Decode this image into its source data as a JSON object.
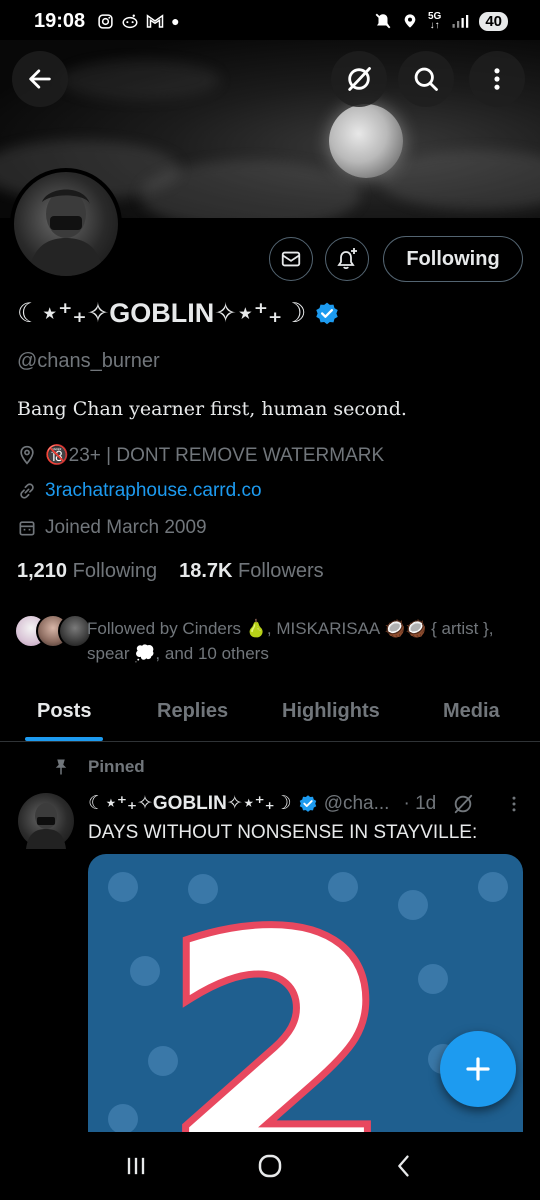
{
  "status_bar": {
    "time": "19:08",
    "left_icons": [
      "instagram-icon",
      "reddit-icon",
      "gmail-icon",
      "dot-icon"
    ],
    "network": "5G",
    "battery": "40"
  },
  "header": {
    "back_icon": "arrow-left-icon",
    "grok_icon": "grok-icon",
    "search_icon": "search-icon",
    "more_icon": "more-vertical-icon"
  },
  "profile": {
    "name": "☾⋆⁺₊✧GOBLIN✧⋆⁺₊☽",
    "verified": true,
    "handle": "@chans_burner",
    "bio": "Bang Chan yearner first, human second.",
    "location": "🔞23+ | DONT REMOVE WATERMARK",
    "website": "3rachatraphouse.carrd.co",
    "joined": "Joined March 2009",
    "following_count": "1,210",
    "following_label": "Following",
    "followers_count": "18.7K",
    "followers_label": "Followers",
    "followed_by": "Followed by Cinders 🍐, MISKARISAA 🥥🥥 { artist }, spear 💭, and 10 others",
    "follow_button_label": "Following"
  },
  "tabs": [
    {
      "label": "Posts",
      "active": true
    },
    {
      "label": "Replies",
      "active": false
    },
    {
      "label": "Highlights",
      "active": false
    },
    {
      "label": "Media",
      "active": false
    }
  ],
  "pinned_post": {
    "pinned_label": "Pinned",
    "author_name": "☾⋆⁺₊✧GOBLIN✧⋆⁺₊☽",
    "author_handle": "@cha...",
    "time": "· 1d",
    "text": "DAYS WITHOUT NONSENSE IN STAYVILLE:",
    "image_text": "2"
  },
  "colors": {
    "accent": "#1d9bf0",
    "background": "#000000",
    "text_primary": "#e7e9ea",
    "text_secondary": "#71767b",
    "border": "#2f3336"
  }
}
